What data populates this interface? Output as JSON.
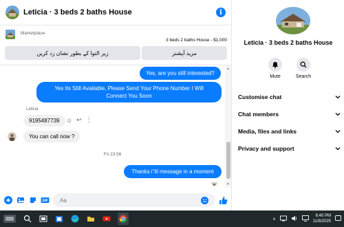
{
  "chat": {
    "title": "Leticia · 3 beds 2 baths House",
    "info_icon": "info-icon",
    "marketplace": {
      "label": "Marketplace",
      "listing": "3 beds 2 baths House - $1,000",
      "quick_replies": [
        "زیر التوا کے بطور نشان زد کریں",
        "مزید آپشنز"
      ]
    },
    "messages": {
      "out_1": "Yes, are you still interested?",
      "out_2_line1": "Yes Its Still Available, Please Send Your Phone Number I Will",
      "out_2_line2": "Connect You Soon",
      "sender_name": "Leticia",
      "in_1": "9195487739",
      "in_2": "You can call now ?",
      "timestamp": "Fri 23:56",
      "out_3": "Thanks i\"ill message in a moment"
    },
    "composer": {
      "placeholder": "Aa"
    }
  },
  "side": {
    "name": "Leticia · 3 beds 2 baths House",
    "actions": [
      {
        "label": "Mute",
        "icon": "bell-icon"
      },
      {
        "label": "Search",
        "icon": "search-icon"
      }
    ],
    "menu": [
      {
        "label": "Customise chat"
      },
      {
        "label": "Chat members"
      },
      {
        "label": "Media, files and links"
      },
      {
        "label": "Privacy and support"
      }
    ]
  },
  "taskbar": {
    "time": "6:40 PM",
    "date": "11/8/2025",
    "apps": [
      "start-icon",
      "search-icon",
      "task-view-icon",
      "file-explorer-icon",
      "edge-icon",
      "folder-icon",
      "youtube-icon",
      "chrome-icon"
    ]
  },
  "colors": {
    "accent": "#0a7cff",
    "bubble_in": "#f0f0f0",
    "taskbar": "#20282c"
  }
}
